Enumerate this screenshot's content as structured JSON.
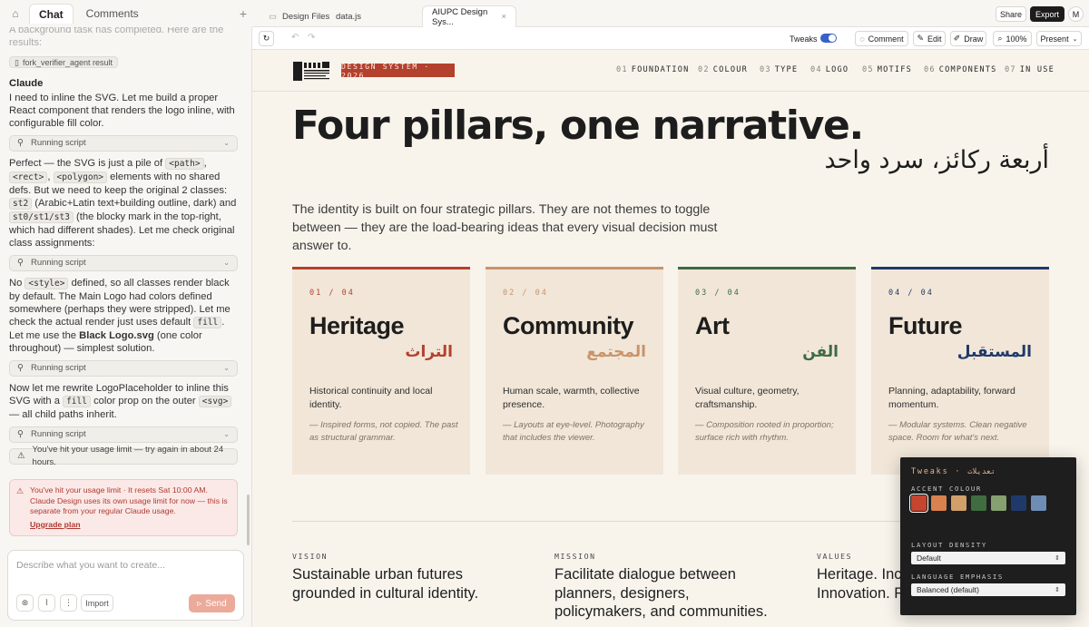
{
  "left_tabs": {
    "chat": "Chat",
    "comments": "Comments"
  },
  "chat": {
    "faded_line": "A background task has completed. Here are the results:",
    "result_chip": "fork_verifier_agent result",
    "speaker": "Claude",
    "msg1": "I need to inline the SVG. Let me build a proper React component that renders the logo inline, with configurable fill color.",
    "run_label": "Running script",
    "msg2_a": "Perfect — the SVG is just a pile of ",
    "msg2_code1": "<path>",
    "msg2_sep1": ", ",
    "msg2_code2": "<rect>",
    "msg2_sep2": ", ",
    "msg2_code3": "<polygon>",
    "msg2_b": " elements with no shared defs. But we need to keep the original 2 classes: ",
    "msg2_code4": "st2",
    "msg2_c": " (Arabic+Latin text+building outline, dark) and ",
    "msg2_code5": "st0/st1/st3",
    "msg2_d": " (the blocky mark in the top-right, which had different shades). Let me check original class assignments:",
    "msg3_a": "No ",
    "msg3_code1": "<style>",
    "msg3_b": " defined, so all classes render black by default. The Main Logo had colors defined somewhere (perhaps they were stripped). Let me check the actual render just uses default ",
    "msg3_code2": "fill",
    "msg3_c": ". Let me use the ",
    "msg3_bold": "Black Logo.svg",
    "msg3_d": " (one color throughout) — simplest solution.",
    "msg4_a": "Now let me rewrite LogoPlaceholder to inline this SVG with a ",
    "msg4_code1": "fill",
    "msg4_b": " color prop on the outer ",
    "msg4_code2": "<svg>",
    "msg4_c": " — all child paths inherit.",
    "limit_row": "You've hit your usage limit — try again in about 24 hours.",
    "alert_text": "You've hit your usage limit · It resets Sat 10:00 AM. Claude Design uses its own usage limit for now — this is separate from your regular Claude usage.",
    "alert_link": "Upgrade plan"
  },
  "composer": {
    "placeholder": "Describe what you want to create...",
    "import": "Import",
    "send": "Send"
  },
  "file_tabs": {
    "design_files": "Design Files",
    "data_js": "data.js",
    "active": "AIUPC Design Sys..."
  },
  "top_buttons": {
    "share": "Share",
    "export": "Export",
    "avatar": "M"
  },
  "toolbar": {
    "tweaks": "Tweaks",
    "comment": "Comment",
    "edit": "Edit",
    "draw": "Draw",
    "zoom": "100%",
    "present": "Present"
  },
  "ds": {
    "badge": "DESIGN SYSTEM · 2026",
    "nav": [
      {
        "n": "01",
        "label": "FOUNDATION"
      },
      {
        "n": "02",
        "label": "COLOUR"
      },
      {
        "n": "03",
        "label": "TYPE"
      },
      {
        "n": "04",
        "label": "LOGO"
      },
      {
        "n": "05",
        "label": "MOTIFS"
      },
      {
        "n": "06",
        "label": "COMPONENTS"
      },
      {
        "n": "07",
        "label": "IN USE"
      }
    ],
    "title": "Four pillars, one narrative.",
    "title_ar": "أربعة ركائز، سرد واحد",
    "lede": "The identity is built on four strategic pillars. They are not themes to toggle between — they are the load-bearing ideas that every visual decision must answer to.",
    "pillars": [
      {
        "num": "01 / 04",
        "name": "Heritage",
        "ar": "التراث",
        "desc": "Historical continuity and local identity.",
        "quote": "— Inspired forms, not copied. The past as structural grammar.",
        "color": "#b4402e"
      },
      {
        "num": "02 / 04",
        "name": "Community",
        "ar": "المجتمع",
        "desc": "Human scale, warmth, collective presence.",
        "quote": "— Layouts at eye-level. Photography that includes the viewer.",
        "color": "#c9936a"
      },
      {
        "num": "03 / 04",
        "name": "Art",
        "ar": "الفن",
        "desc": "Visual culture, geometry, craftsmanship.",
        "quote": "— Composition rooted in proportion; surface rich with rhythm.",
        "color": "#3d6b45"
      },
      {
        "num": "04 / 04",
        "name": "Future",
        "ar": "المستقبل",
        "desc": "Planning, adaptability, forward momentum.",
        "quote": "— Modular systems. Clean negative space. Room for what's next.",
        "color": "#1f3a6a"
      }
    ],
    "vision_label": "VISION",
    "vision_text": "Sustainable urban futures grounded in cultural identity.",
    "mission_label": "MISSION",
    "mission_text": "Facilitate dialogue between planners, designers, policymakers, and communities.",
    "values_label": "VALUES",
    "values_text": "Heritage. Inclusion. Innovation. Resilience."
  },
  "tweaks": {
    "title": "Tweaks · تعديلات",
    "accent_label": "ACCENT COLOUR",
    "swatches": [
      "#c5452f",
      "#d9824f",
      "#d1a06a",
      "#3f6d40",
      "#86a070",
      "#1f3a6a",
      "#6f8db4"
    ],
    "density_label": "LAYOUT DENSITY",
    "density_value": "Default",
    "language_label": "LANGUAGE EMPHASIS",
    "language_value": "Balanced (default)"
  }
}
